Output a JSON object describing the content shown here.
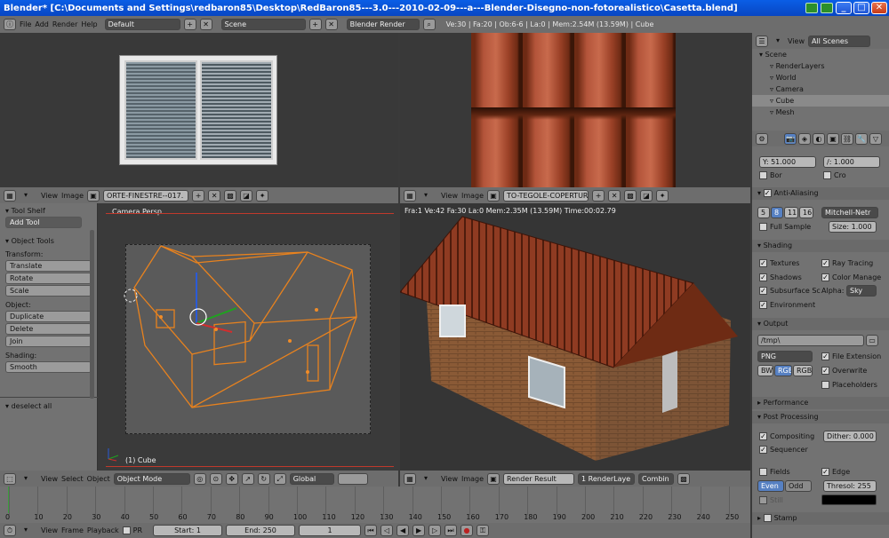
{
  "window": {
    "title": "Blender* [C:\\Documents and Settings\\redbaron85\\Desktop\\RedBaron85---3.0---2010-02-09---a---Blender-Disegno-non-fotorealistico\\Casetta.blend]"
  },
  "info_header": {
    "menus": [
      "File",
      "Add",
      "Render",
      "Help"
    ],
    "screen_layout": "Default",
    "scene": "Scene",
    "render_engine": "Blender Render",
    "stats": "Ve:30 | Fa:20 | Ob:6-6 | La:0 | Mem:2.54M (13.59M) | Cube"
  },
  "image_editor_left": {
    "menus": [
      "View",
      "Image"
    ],
    "image_name": "ORTE-FINESTRE--017."
  },
  "image_editor_right": {
    "menus": [
      "View",
      "Image"
    ],
    "image_name": "TO-TEGOLE-COPERTUR"
  },
  "tool_shelf": {
    "title": "Tool Shelf",
    "add_tool": "Add Tool",
    "object_tools": "Object Tools",
    "transform_label": "Transform:",
    "transform_buttons": [
      "Translate",
      "Rotate",
      "Scale"
    ],
    "object_label": "Object:",
    "object_buttons": [
      "Duplicate",
      "Delete",
      "Join"
    ],
    "shading_label": "Shading:",
    "shading_buttons": [
      "Smooth"
    ],
    "last_op": "deselect all"
  },
  "viewport3d": {
    "label": "Camera Persp",
    "object_label": "(1) Cube",
    "menus": [
      "View",
      "Select",
      "Object"
    ],
    "mode": "Object Mode",
    "orientation": "Global"
  },
  "render_view": {
    "stats": "Fra:1  Ve:42 Fa:30 La:0 Mem:2.35M (13.59M) Time:00:02.79",
    "menus": [
      "View",
      "Image"
    ],
    "image": "Render Result",
    "layer": "1 RenderLaye",
    "pass": "Combin"
  },
  "outliner": {
    "view_label": "View",
    "filter": "All Scenes",
    "items": [
      {
        "name": "Scene",
        "indent": 0
      },
      {
        "name": "RenderLayers",
        "indent": 1
      },
      {
        "name": "World",
        "indent": 1
      },
      {
        "name": "Camera",
        "indent": 1
      },
      {
        "name": "Cube",
        "indent": 1
      },
      {
        "name": "Mesh",
        "indent": 1
      }
    ]
  },
  "properties": {
    "res_y": "Y: 51.000",
    "res_aspect": "/: 1.000",
    "border": "Bor",
    "crop": "Cro",
    "anti_aliasing": {
      "title": "Anti-Aliasing",
      "samples": [
        "5",
        "8",
        "11",
        "16"
      ],
      "filter": "Mitchell-Netr",
      "full_sample": "Full Sample",
      "size": "Size: 1.000"
    },
    "shading": {
      "title": "Shading",
      "textures": "Textures",
      "ray_tracing": "Ray Tracing",
      "shadows": "Shadows",
      "color_manage": "Color Manage",
      "subsurface": "Subsurface Sc",
      "alpha_label": "Alpha:",
      "alpha_value": "Sky",
      "environment": "Environment"
    },
    "output": {
      "title": "Output",
      "path": "/tmp\\",
      "format": "PNG",
      "file_extension": "File Extension",
      "modes": [
        "BW",
        "RGB",
        "RGBA"
      ],
      "overwrite": "Overwrite",
      "placeholders": "Placeholders"
    },
    "performance": "Performance",
    "post_processing": {
      "title": "Post Processing",
      "compositing": "Compositing",
      "dither": "Dither: 0.000",
      "sequencer": "Sequencer",
      "fields": "Fields",
      "edge": "Edge",
      "even": "Even",
      "odd": "Odd",
      "threshold": "Thresol: 255",
      "still": "Still"
    },
    "stamp": "Stamp"
  },
  "timeline": {
    "ticks": [
      "0",
      "10",
      "20",
      "30",
      "40",
      "50",
      "60",
      "70",
      "80",
      "90",
      "100",
      "110",
      "120",
      "130",
      "140",
      "150",
      "160",
      "170",
      "180",
      "190",
      "200",
      "210",
      "220",
      "230",
      "240",
      "250"
    ],
    "menus": [
      "View",
      "Frame",
      "Playback"
    ],
    "pr": "PR",
    "start": "Start: 1",
    "end": "End: 250",
    "current": "1"
  },
  "colors": {
    "accent_blue": "#5680c2",
    "selection_orange": "#f08c28",
    "roof_red": "#8f3b22",
    "brick": "#8a5a36"
  }
}
